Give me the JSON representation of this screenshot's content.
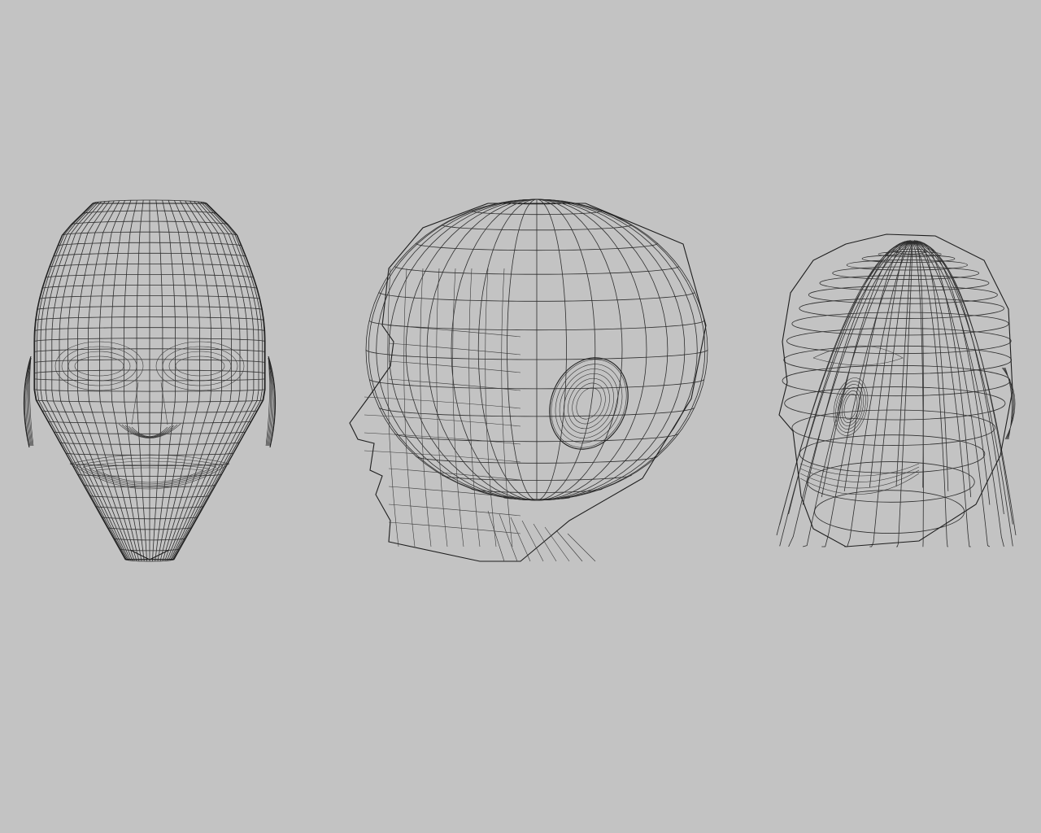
{
  "scene": {
    "background": "#c3c3c3",
    "line_color": "#2e2e2e",
    "views": [
      {
        "id": "front",
        "subject": "head-wireframe-front"
      },
      {
        "id": "side",
        "subject": "head-wireframe-side"
      },
      {
        "id": "three-quarter",
        "subject": "head-wireframe-three-quarter"
      }
    ]
  }
}
